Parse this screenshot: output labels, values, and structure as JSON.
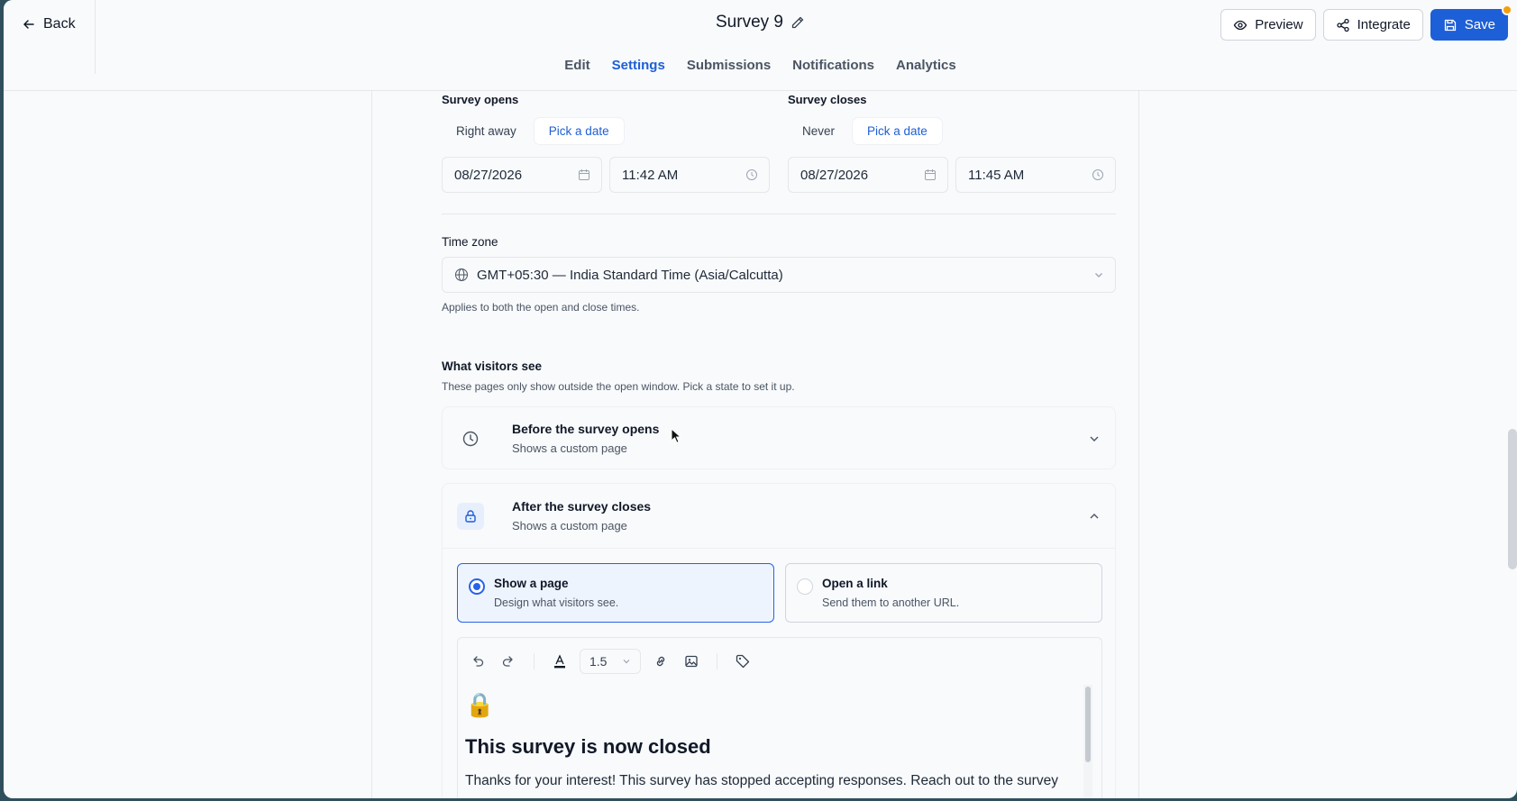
{
  "header": {
    "back_label": "Back",
    "title": "Survey 9",
    "tabs": [
      "Edit",
      "Settings",
      "Submissions",
      "Notifications",
      "Analytics"
    ],
    "active_tab": "Settings",
    "preview_label": "Preview",
    "integrate_label": "Integrate",
    "save_label": "Save"
  },
  "schedule": {
    "opens": {
      "label": "Survey opens",
      "options": [
        "Right away",
        "Pick a date"
      ],
      "selected": "Pick a date",
      "date": "08/27/2026",
      "time": "11:42 AM"
    },
    "closes": {
      "label": "Survey closes",
      "options": [
        "Never",
        "Pick a date"
      ],
      "selected": "Pick a date",
      "date": "08/27/2026",
      "time": "11:45 AM"
    }
  },
  "timezone": {
    "label": "Time zone",
    "value": "GMT+05:30 — India Standard Time (Asia/Calcutta)",
    "help": "Applies to both the open and close times."
  },
  "visitors": {
    "title": "What visitors see",
    "description": "These pages only show outside the open window. Pick a state to set it up.",
    "before": {
      "title": "Before the survey opens",
      "subtitle": "Shows a custom page",
      "expanded": false
    },
    "after": {
      "title": "After the survey closes",
      "subtitle": "Shows a custom page",
      "expanded": true
    },
    "options": [
      {
        "title": "Show a page",
        "subtitle": "Design what visitors see.",
        "selected": true
      },
      {
        "title": "Open a link",
        "subtitle": "Send them to another URL.",
        "selected": false
      }
    ]
  },
  "editor": {
    "line_height": "1.5",
    "emoji": "🔒",
    "heading": "This survey is now closed",
    "body": "Thanks for your interest! This survey has stopped accepting responses. Reach out to the survey"
  },
  "colors": {
    "accent": "#1d5fd6",
    "notification_dot": "#f59e0b"
  }
}
